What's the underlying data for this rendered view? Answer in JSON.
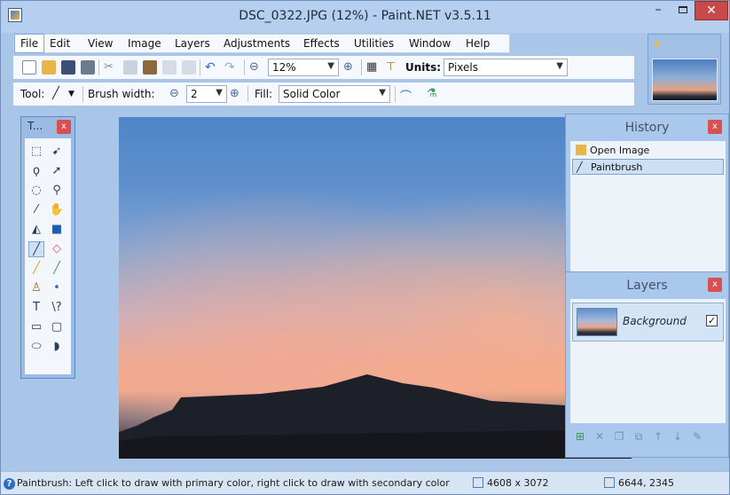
{
  "window": {
    "title": "DSC_0322.JPG (12%) - Paint.NET v3.5.11",
    "min_label": "–",
    "close_label": "✕"
  },
  "menu": {
    "items": [
      "File",
      "Edit",
      "View",
      "Image",
      "Layers",
      "Adjustments",
      "Effects",
      "Utilities",
      "Window",
      "Help"
    ]
  },
  "toolbar1": {
    "zoom_value": "12%",
    "units_label": "Units:",
    "units_value": "Pixels"
  },
  "toolbar2": {
    "tool_label": "Tool:",
    "brush_width_label": "Brush width:",
    "brush_width_value": "2",
    "fill_label": "Fill:",
    "fill_value": "Solid Color"
  },
  "tools_panel": {
    "title": "T...",
    "close_label": "x"
  },
  "history_panel": {
    "title": "History",
    "close_label": "x",
    "items": [
      {
        "label": "Open Image",
        "selected": false
      },
      {
        "label": "Paintbrush",
        "selected": true
      }
    ]
  },
  "layers_panel": {
    "title": "Layers",
    "close_label": "x",
    "layers": [
      {
        "name": "Background",
        "visible_mark": "✓"
      }
    ]
  },
  "statusbar": {
    "message": "Paintbrush: Left click to draw with primary color, right click to draw with secondary color",
    "image_size": "4608 x 3072",
    "cursor_pos": "6644, 2345"
  },
  "colors": {
    "accent": "#2f6dc4",
    "close_red": "#c74a4a",
    "panel_blue": "#a9c8ec"
  }
}
